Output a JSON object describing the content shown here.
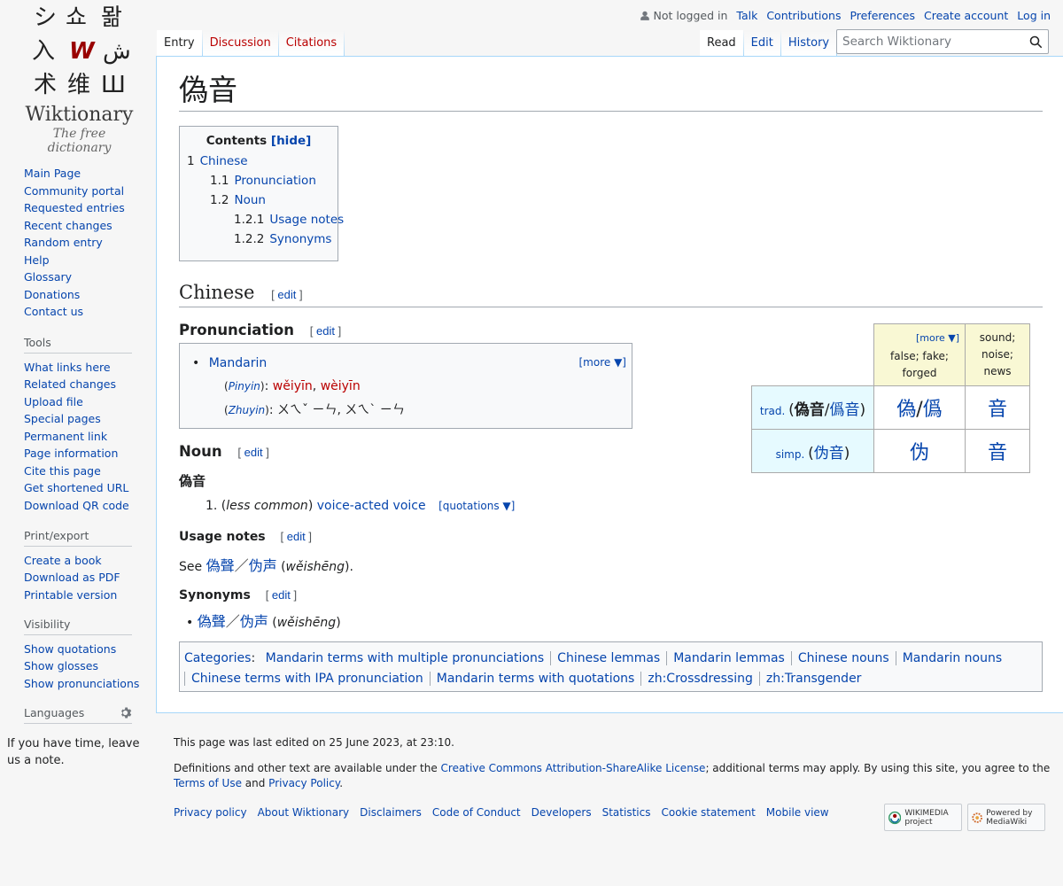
{
  "logo": {
    "wordmark": "Wiktionary",
    "tagline": "The free dictionary"
  },
  "personal": {
    "not_logged_in": "Not logged in",
    "talk": "Talk",
    "contributions": "Contributions",
    "preferences": "Preferences",
    "create_account": "Create account",
    "log_in": "Log in"
  },
  "tabs_left": {
    "entry": "Entry",
    "discussion": "Discussion",
    "citations": "Citations"
  },
  "tabs_right": {
    "read": "Read",
    "edit": "Edit",
    "history": "History"
  },
  "search": {
    "placeholder": "Search Wiktionary"
  },
  "nav": [
    "Main Page",
    "Community portal",
    "Requested entries",
    "Recent changes",
    "Random entry",
    "Help",
    "Glossary",
    "Donations",
    "Contact us"
  ],
  "tools": {
    "heading": "Tools",
    "items": [
      "What links here",
      "Related changes",
      "Upload file",
      "Special pages",
      "Permanent link",
      "Page information",
      "Cite this page",
      "Get shortened URL",
      "Download QR code"
    ]
  },
  "print": {
    "heading": "Print/export",
    "items": [
      "Create a book",
      "Download as PDF",
      "Printable version"
    ]
  },
  "visibility": {
    "heading": "Visibility",
    "items": [
      "Show quotations",
      "Show glosses",
      "Show pronunciations"
    ]
  },
  "languages": {
    "heading": "Languages",
    "note": "If you have time, leave us a note."
  },
  "title": "偽音",
  "toc": {
    "heading": "Contents",
    "hide": "[hide]",
    "items": [
      {
        "num": "1",
        "label": "Chinese"
      },
      {
        "num": "1.1",
        "label": "Pronunciation"
      },
      {
        "num": "1.2",
        "label": "Noun"
      },
      {
        "num": "1.2.1",
        "label": "Usage notes"
      },
      {
        "num": "1.2.2",
        "label": "Synonyms"
      }
    ]
  },
  "edit_label": "edit",
  "sections": {
    "chinese": "Chinese",
    "pronunciation": "Pronunciation",
    "noun": "Noun",
    "usage": "Usage notes",
    "synonyms": "Synonyms"
  },
  "pron": {
    "more": "[more ▼]",
    "lang": "Mandarin",
    "pinyin_label": "Pinyin",
    "pinyin_1": "wěiyīn",
    "pinyin_2": "wèiyīn",
    "zhuyin_label": "Zhuyin",
    "zhuyin": "ㄨㄟˇ ㄧㄣ, ㄨㄟˋ ㄧㄣ"
  },
  "headword": "偽音",
  "definition": {
    "num": "1.",
    "qual": "less common",
    "gloss": "voice-acted voice",
    "quot": "[quotations ▼]"
  },
  "usage": {
    "see": "See",
    "w1": "偽聲",
    "slash": "／",
    "w2": "伪声",
    "rom": "wěishēng"
  },
  "synonyms": {
    "w1": "偽聲",
    "slash": "／",
    "w2": "伪声",
    "rom": "wěishēng"
  },
  "zh_table": {
    "more": "[more ▼]",
    "gloss1": "false; fake; forged",
    "gloss2": "sound; noise; news",
    "trad_label": "trad.",
    "trad_form_a": "偽音",
    "trad_form_b": "僞音",
    "trad_char1a": "偽",
    "trad_char1b": "僞",
    "trad_char2": "音",
    "simp_label": "simp.",
    "simp_form": "伪音",
    "simp_char1": "伪",
    "simp_char2": "音"
  },
  "categories": {
    "label": "Categories",
    "items": [
      "Mandarin terms with multiple pronunciations",
      "Chinese lemmas",
      "Mandarin lemmas",
      "Chinese nouns",
      "Mandarin nouns",
      "Chinese terms with IPA pronunciation",
      "Mandarin terms with quotations",
      "zh:Crossdressing",
      "zh:Transgender"
    ]
  },
  "footer": {
    "last_edited": "This page was last edited on 25 June 2023, at 23:10.",
    "license_pre": "Definitions and other text are available under the ",
    "license_link": "Creative Commons Attribution-ShareAlike License",
    "license_mid": "; additional terms may apply. By using this site, you agree to the ",
    "terms": "Terms of Use",
    "and": " and ",
    "privacy": "Privacy Policy",
    "period": ".",
    "links": [
      "Privacy policy",
      "About Wiktionary",
      "Disclaimers",
      "Code of Conduct",
      "Developers",
      "Statistics",
      "Cookie statement",
      "Mobile view"
    ],
    "badge1": "WIKIMEDIA project",
    "badge2": "Powered by MediaWiki"
  }
}
